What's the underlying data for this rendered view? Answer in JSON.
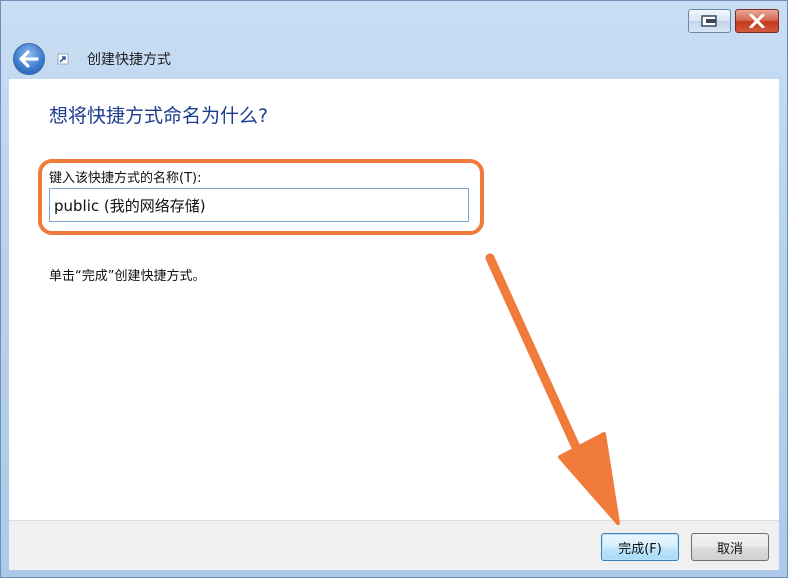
{
  "window": {
    "title": "创建快捷方式"
  },
  "page": {
    "heading": "想将快捷方式命名为什么?",
    "field_label": "键入该快捷方式的名称(T):",
    "name_value": "public (我的网络存储)",
    "hint": "单击“完成”创建快捷方式。"
  },
  "buttons": {
    "finish": "完成(F)",
    "cancel": "取消"
  },
  "icons": {
    "back": "back-arrow-icon",
    "shortcut": "shortcut-icon",
    "restore": "restore-window-icon",
    "close": "close-icon"
  },
  "colors": {
    "heading": "#1b3d8f",
    "annotation": "#f07b3a",
    "finish_button_border": "#3c7fb1"
  }
}
